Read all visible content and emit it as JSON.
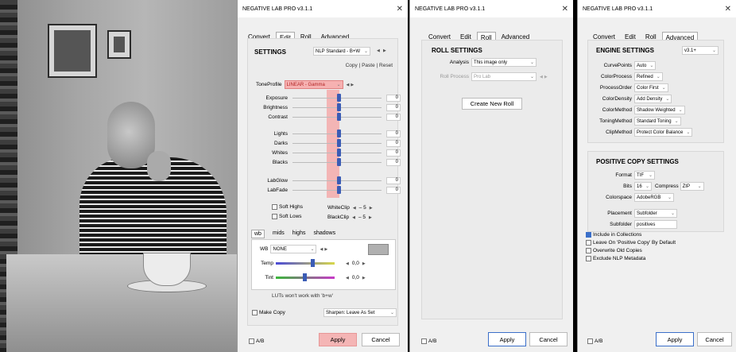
{
  "panel1": {
    "title": "NEGATIVE LAB PRO v3.1.1",
    "tabs": [
      "Convert",
      "Edit",
      "Roll",
      "Advanced"
    ],
    "settings_label": "SETTINGS",
    "preset": "NLP Standard - B+W",
    "copy": "Copy",
    "paste": "Paste",
    "reset": "Reset",
    "tone_profile_label": "ToneProfile",
    "tone_profile_value": "LINEAR - Gamma",
    "sliders1": [
      {
        "label": "Exposure",
        "value": "0"
      },
      {
        "label": "Brightness",
        "value": "0"
      },
      {
        "label": "Contrast",
        "value": "0"
      }
    ],
    "sliders2": [
      {
        "label": "Lights",
        "value": "0"
      },
      {
        "label": "Darks",
        "value": "0"
      },
      {
        "label": "Whites",
        "value": "0"
      },
      {
        "label": "Blacks",
        "value": "0"
      }
    ],
    "sliders3": [
      {
        "label": "LabGlow",
        "value": "0"
      },
      {
        "label": "LabFade",
        "value": "0"
      }
    ],
    "soft_highs": "Soft Highs",
    "soft_lows": "Soft Lows",
    "white_clip_label": "WhiteClip",
    "white_clip_value": "– 5",
    "black_clip_label": "BlackClip",
    "black_clip_value": "– 5",
    "sub_tabs": [
      "wb",
      "mids",
      "highs",
      "shadows"
    ],
    "wb_label": "WB",
    "wb_value": "NONE",
    "temp_label": "Temp",
    "temp_value": "0,0",
    "tint_label": "Tint",
    "tint_value": "0,0",
    "lut_note": "LUTs won't work with 'b+w'",
    "make_copy": "Make Copy",
    "sharpen": "Sharpen: Leave As Set",
    "ab": "A/B",
    "apply": "Apply",
    "cancel": "Cancel"
  },
  "panel2": {
    "title": "NEGATIVE LAB PRO v3.1.1",
    "tabs": [
      "Convert",
      "Edit",
      "Roll",
      "Advanced"
    ],
    "roll_settings": "ROLL SETTINGS",
    "analysis_label": "Analysis",
    "analysis_value": "This image only",
    "roll_process_label": "Roll Process",
    "roll_process_value": "Pro Lab",
    "create_new_roll": "Create New Roll",
    "ab": "A/B",
    "apply": "Apply",
    "cancel": "Cancel"
  },
  "panel3": {
    "title": "NEGATIVE LAB PRO v3.1.1",
    "tabs": [
      "Convert",
      "Edit",
      "Roll",
      "Advanced"
    ],
    "engine_settings": "ENGINE SETTINGS",
    "engine_version": "v3.1+",
    "engine_rows": [
      {
        "label": "CurvePoints",
        "value": "Auto"
      },
      {
        "label": "ColorProcess",
        "value": "Refined"
      },
      {
        "label": "ProcessOrder",
        "value": "Color First"
      },
      {
        "label": "ColorDensity",
        "value": "Add Density"
      },
      {
        "label": "ColorMethod",
        "value": "Shadow Weighted"
      },
      {
        "label": "ToningMethod",
        "value": "Standard Toning"
      },
      {
        "label": "ClipMethod",
        "value": "Protect Color Balance"
      }
    ],
    "positive_copy": "POSITIVE COPY SETTINGS",
    "format_label": "Format",
    "format_value": "TIF",
    "bits_label": "Bits",
    "bits_value": "16",
    "compress_label": "Compress",
    "compress_value": "ZIP",
    "colorspace_label": "Colorspace",
    "colorspace_value": "AdobeRGB",
    "placement_label": "Placement",
    "placement_value": "Subfolder",
    "subfolder_label": "Subfolder",
    "subfolder_value": "positives",
    "checks": [
      {
        "label": "Include in Collections",
        "checked": true
      },
      {
        "label": "Leave On 'Positive Copy' By Default",
        "checked": false
      },
      {
        "label": "Overwrite Old Copies",
        "checked": false
      },
      {
        "label": "Exclude NLP Metadata",
        "checked": false
      }
    ],
    "ab": "A/B",
    "apply": "Apply",
    "cancel": "Cancel"
  }
}
